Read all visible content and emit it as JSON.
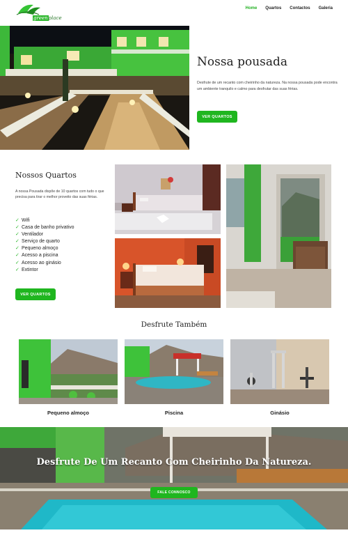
{
  "header": {
    "logo_green": "green",
    "logo_place": "place",
    "nav": [
      "Home",
      "Quartos",
      "Contactos",
      "Galeria"
    ]
  },
  "hero": {
    "title": "Nossa pousada",
    "text": "Desfrute de um recanto com cheirinho da natureza. Na nossa pousada pode encontra um ambiente tranquilo e calmo para desfrutar das suas férias.",
    "button": "VER QUARTOS"
  },
  "quartos": {
    "title": "Nossos Quartos",
    "text": "A nossa Pousada dispõe de 10 quartos com tudo o que precisa para tirar o melhor proveito das suas férias.",
    "features": [
      "Wifi",
      "Casa de banho privativo",
      "Ventilador",
      "Serviço de quarto",
      "Pequeno almoço",
      "Acesso a piscina",
      "Acesso ao ginásio",
      "Extintor"
    ],
    "button": "VER QUARTOS"
  },
  "desfrute": {
    "title": "Desfrute Também",
    "cards": [
      "Pequeno almoço",
      "Piscina",
      "Ginásio"
    ]
  },
  "banner": {
    "title": "Desfrute De Um Recanto Com Cheirinho Da Natureza.",
    "button": "FALE CONNOSCO"
  },
  "colors": {
    "accent": "#1fb61f",
    "nav_active": "#22b022"
  }
}
